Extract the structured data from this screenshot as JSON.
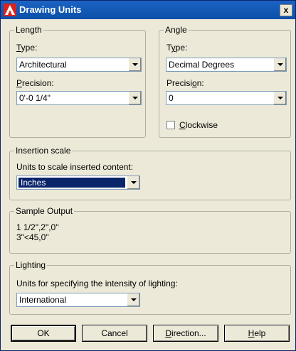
{
  "window": {
    "title": "Drawing Units",
    "close_glyph": "x"
  },
  "length": {
    "legend": "Length",
    "type_label": "Type:",
    "type_value": "Architectural",
    "precision_label": "Precision:",
    "precision_value": "0'-0 1/4\""
  },
  "angle": {
    "legend": "Angle",
    "type_label": "Type:",
    "type_value": "Decimal Degrees",
    "precision_label": "Precision:",
    "precision_value": "0",
    "clockwise_label": "Clockwise",
    "clockwise_checked": false
  },
  "insertion": {
    "legend": "Insertion scale",
    "label": "Units to scale inserted content:",
    "value": "Inches"
  },
  "sample": {
    "legend": "Sample Output",
    "lines": [
      "1 1/2\",2\",0\"",
      "3\"<45,0\""
    ]
  },
  "lighting": {
    "legend": "Lighting",
    "label": "Units for specifying the intensity of lighting:",
    "value": "International"
  },
  "buttons": {
    "ok": "OK",
    "cancel": "Cancel",
    "direction": "Direction...",
    "help": "Help"
  },
  "colors": {
    "titlebar": "#0b4fa8",
    "dialog_bg": "#ece9d8",
    "selection": "#0a246a"
  }
}
